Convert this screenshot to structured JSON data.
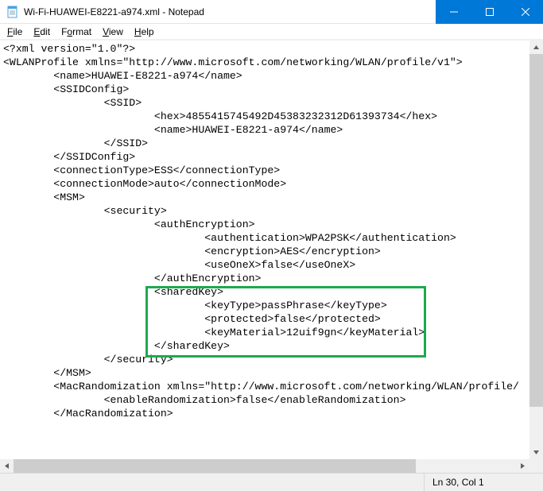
{
  "window": {
    "title": "Wi-Fi-HUAWEI-E8221-a974.xml - Notepad"
  },
  "menu": {
    "file": "File",
    "edit": "Edit",
    "format": "Format",
    "view": "View",
    "help": "Help"
  },
  "content": {
    "l1": "<?xml version=\"1.0\"?>",
    "l2": "<WLANProfile xmlns=\"http://www.microsoft.com/networking/WLAN/profile/v1\">",
    "l3": "        <name>HUAWEI-E8221-a974</name>",
    "l4": "        <SSIDConfig>",
    "l5": "                <SSID>",
    "l6": "                        <hex>4855415745492D45383232312D61393734</hex>",
    "l7": "                        <name>HUAWEI-E8221-a974</name>",
    "l8": "                </SSID>",
    "l9": "        </SSIDConfig>",
    "l10": "        <connectionType>ESS</connectionType>",
    "l11": "        <connectionMode>auto</connectionMode>",
    "l12": "        <MSM>",
    "l13": "                <security>",
    "l14": "                        <authEncryption>",
    "l15": "                                <authentication>WPA2PSK</authentication>",
    "l16": "                                <encryption>AES</encryption>",
    "l17": "                                <useOneX>false</useOneX>",
    "l18": "                        </authEncryption>",
    "l19": "                        <sharedKey>",
    "l20": "                                <keyType>passPhrase</keyType>",
    "l21": "                                <protected>false</protected>",
    "l22": "                                <keyMaterial>12uif9gn</keyMaterial>",
    "l23": "                        </sharedKey>",
    "l24": "                </security>",
    "l25": "        </MSM>",
    "l26": "        <MacRandomization xmlns=\"http://www.microsoft.com/networking/WLAN/profile/",
    "l27": "                <enableRandomization>false</enableRandomization>",
    "l28": "        </MacRandomization>"
  },
  "status": {
    "position": "Ln 30, Col 1"
  }
}
